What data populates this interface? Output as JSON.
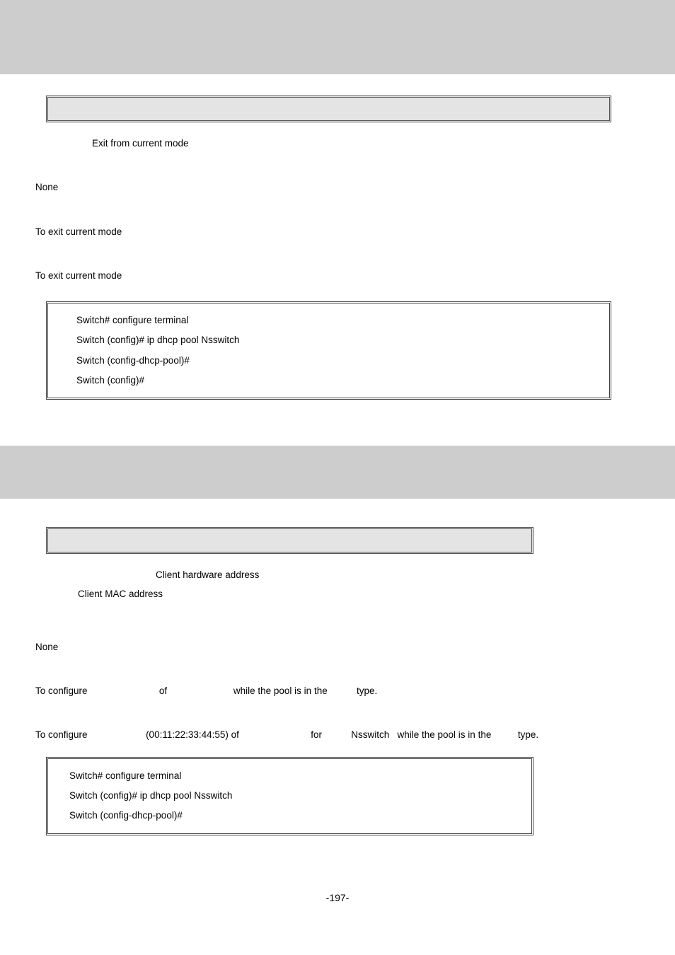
{
  "section1": {
    "desc_exit": "Exit from current mode",
    "default_none": "None",
    "usage": "To exit current mode",
    "example_intro": "To exit current mode",
    "example_lines": [
      "Switch# configure terminal",
      "Switch (config)# ip dhcp pool Nsswitch",
      "Switch (config-dhcp-pool)#",
      "Switch (config)#"
    ]
  },
  "section2": {
    "param_hw_label": "Client hardware address",
    "param_mac_label": "Client MAC address",
    "default_none": "None",
    "usage": {
      "p1": "To configure ",
      "p2": " of ",
      "p3": " while the pool is in the ",
      "p4": " type."
    },
    "example_intro": {
      "p1": "To configure ",
      "p2": " (00:11:22:33:44:55) of ",
      "p3": " for ",
      "p4": "Nsswitch",
      "p5": "   while the pool is in the ",
      "p6": " type."
    },
    "example_lines": [
      "Switch# configure terminal",
      "Switch (config)# ip dhcp pool Nsswitch",
      "Switch (config-dhcp-pool)#"
    ]
  },
  "footer": "-197-"
}
